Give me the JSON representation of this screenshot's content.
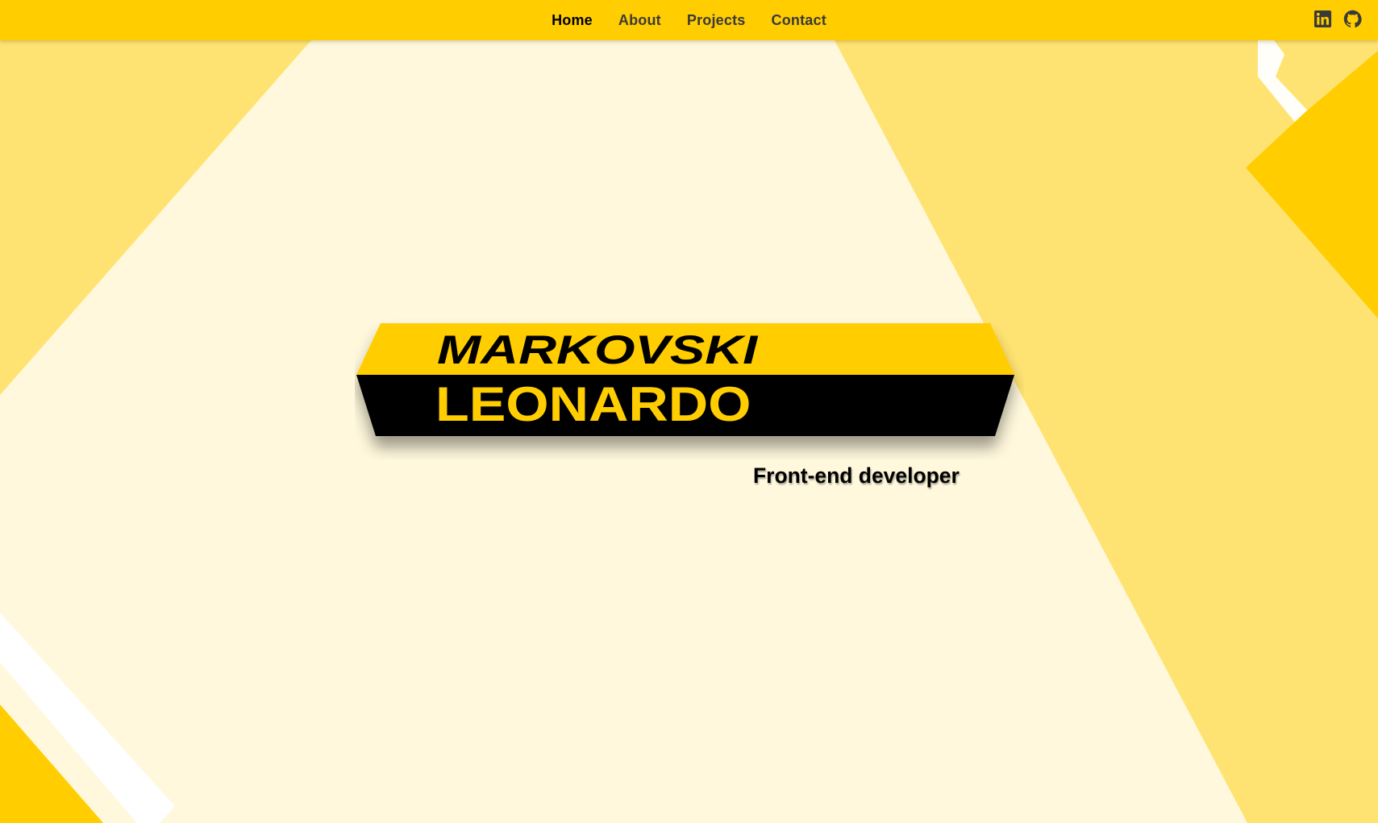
{
  "nav": {
    "links": [
      {
        "label": "Home",
        "active": true
      },
      {
        "label": "About",
        "active": false
      },
      {
        "label": "Projects",
        "active": false
      },
      {
        "label": "Contact",
        "active": false
      }
    ]
  },
  "social": {
    "linkedin_icon": "linkedin-icon",
    "github_icon": "github-icon"
  },
  "hero": {
    "surname": "MARKOVSKI",
    "first_name": "LEONARDO",
    "tagline": "Front-end developer"
  },
  "colors": {
    "accent_yellow": "#ffcd00",
    "light_yellow": "#ffe372",
    "cream": "#fff8dc",
    "black": "#000000"
  }
}
